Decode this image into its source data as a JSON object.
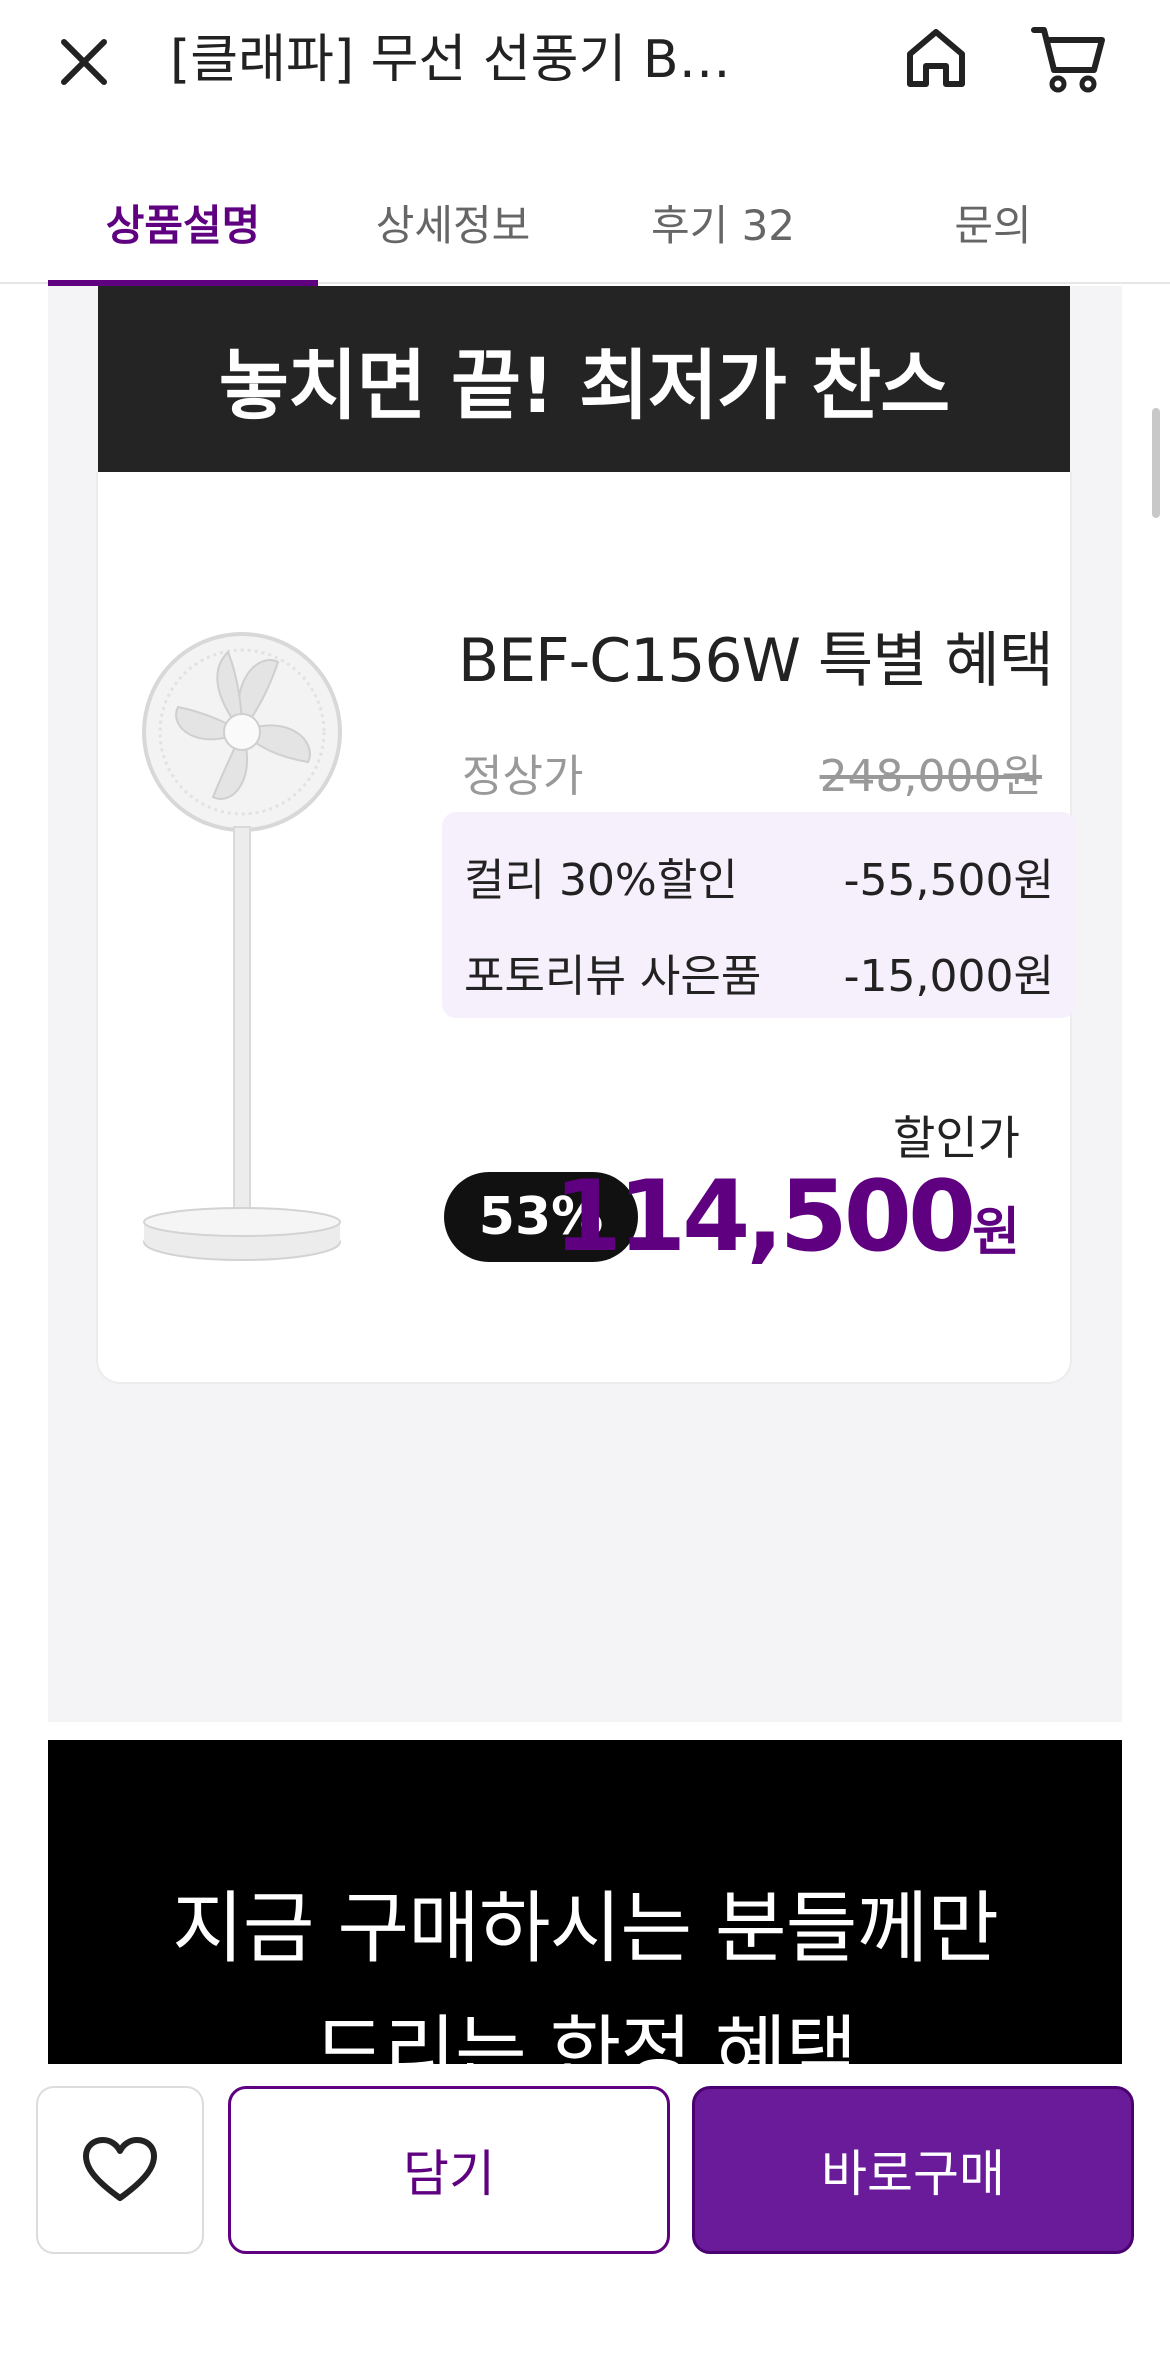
{
  "header": {
    "title": "[클래파] 무선 선풍기 BL...",
    "close_icon": "close-icon",
    "home_icon": "home-icon",
    "cart_icon": "cart-icon"
  },
  "tabs": [
    {
      "label": "상품설명",
      "active": true
    },
    {
      "label": "상세정보",
      "active": false
    },
    {
      "label": "후기 32",
      "active": false
    },
    {
      "label": "문의",
      "active": false
    }
  ],
  "banner": {
    "headline": "놓치면 끝! 최저가 찬스"
  },
  "offer": {
    "product_title": "BEF-C156W 특별 혜택",
    "regular_label": "정상가",
    "regular_price": "248,000원",
    "discounts": [
      {
        "label": "컬리 30%할인",
        "amount": "-55,500원"
      },
      {
        "label": "포토리뷰 사은품",
        "amount": "-15,000원"
      }
    ],
    "sale_label": "할인가",
    "discount_rate": "53%",
    "final_price": "114,500",
    "currency": "원"
  },
  "promo": {
    "line1": "지금 구매하시는 분들께만",
    "line2": "드리는 한정 혜택"
  },
  "bottom_bar": {
    "like_icon": "heart-icon",
    "cart_label": "담기",
    "buy_label": "바로구매"
  },
  "colors": {
    "accent": "#5f0080",
    "buy_button": "#6a1b9a",
    "banner_bg": "#242424",
    "discount_box_bg": "#f6f0fc"
  }
}
